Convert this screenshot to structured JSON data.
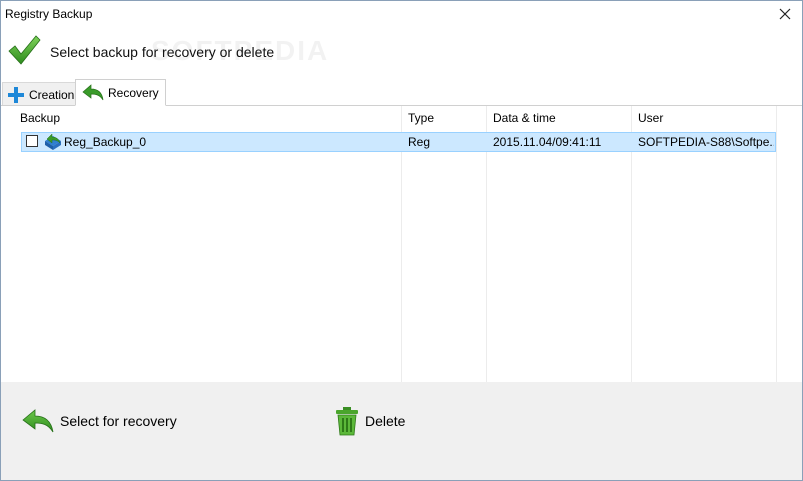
{
  "window": {
    "title": "Registry Backup"
  },
  "header": {
    "instruction": "Select backup for recovery or delete",
    "watermark": "SOFTPEDIA"
  },
  "tabs": [
    {
      "label": "Creation",
      "icon": "plus-icon",
      "active": false
    },
    {
      "label": "Recovery",
      "icon": "back-arrow-icon",
      "active": true
    }
  ],
  "table": {
    "columns": [
      "Backup",
      "Type",
      "Data & time",
      "User"
    ],
    "rows": [
      {
        "checked": false,
        "name": "Reg_Backup_0",
        "type": "Reg",
        "datetime": "2015.11.04/09:41:11",
        "user": "SOFTPEDIA-S88\\Softpe..."
      }
    ]
  },
  "footer": {
    "recovery_label": "Select for recovery",
    "delete_label": "Delete"
  },
  "colors": {
    "selection_bg": "#cce8ff",
    "selection_border": "#99d1ff",
    "accent_green": "#3a9b2a",
    "plus_blue": "#1e88d8"
  }
}
